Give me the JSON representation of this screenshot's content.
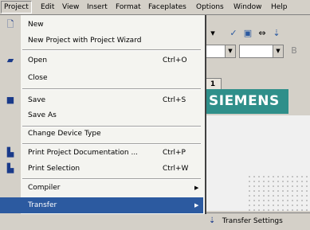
{
  "menubar": {
    "items": [
      {
        "label": "Project"
      },
      {
        "label": "Edit"
      },
      {
        "label": "View"
      },
      {
        "label": "Insert"
      },
      {
        "label": "Format"
      },
      {
        "label": "Faceplates"
      },
      {
        "label": "Options"
      },
      {
        "label": "Window"
      },
      {
        "label": "Help"
      }
    ]
  },
  "project_menu": {
    "items": [
      {
        "label": "New",
        "shortcut": "",
        "icon": "new-document-icon"
      },
      {
        "label": "New Project with Project Wizard",
        "shortcut": ""
      },
      {
        "label": "Open",
        "shortcut": "Ctrl+O",
        "icon": "open-folder-icon"
      },
      {
        "label": "Close",
        "shortcut": ""
      },
      {
        "label": "Save",
        "shortcut": "Ctrl+S",
        "icon": "save-icon"
      },
      {
        "label": "Save As",
        "shortcut": ""
      },
      {
        "label": "Change Device Type",
        "shortcut": ""
      },
      {
        "label": "Print Project Documentation ...",
        "shortcut": "Ctrl+P",
        "icon": "print-icon"
      },
      {
        "label": "Print Selection",
        "shortcut": "Ctrl+W",
        "icon": "print-selection-icon"
      },
      {
        "label": "Compiler",
        "shortcut": "",
        "submenu": true
      },
      {
        "label": "Transfer",
        "shortcut": "",
        "submenu": true
      }
    ]
  },
  "background": {
    "tab_label": "1",
    "brand_text": "SIEMENS",
    "transfer_submenu_item": "Transfer Settings"
  }
}
